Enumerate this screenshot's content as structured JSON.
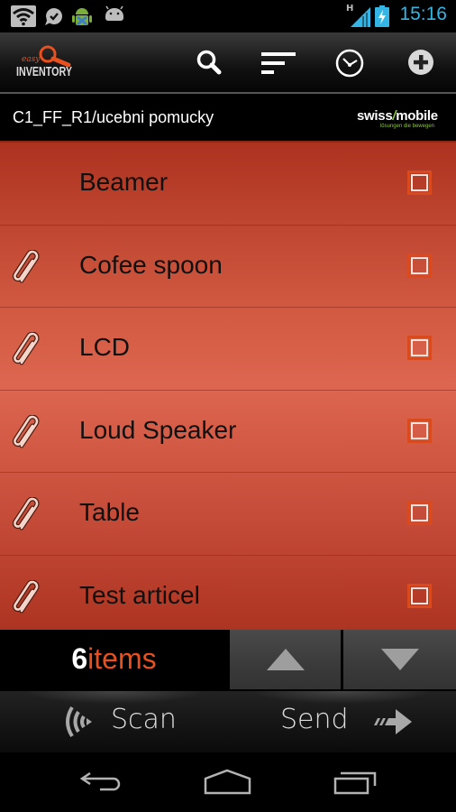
{
  "status_bar": {
    "time": "15:16",
    "network_type": "H",
    "icons": [
      "wifi-icon",
      "check-notification-icon",
      "android-download-icon",
      "android-icon",
      "signal-icon",
      "battery-charging-icon"
    ]
  },
  "action_bar": {
    "app_name": "easy INVENTORY",
    "actions": [
      "search-icon",
      "sort-icon",
      "history-clock-icon",
      "add-icon"
    ]
  },
  "location": {
    "path": "C1_FF_R1/ucebni pomucky",
    "brand_name": "swiss1mobile",
    "brand_tagline": "lösungen die bewegen"
  },
  "items": [
    {
      "label": "Beamer",
      "has_attachment": false,
      "checked": false
    },
    {
      "label": "Cofee spoon",
      "has_attachment": true,
      "checked": false
    },
    {
      "label": "LCD",
      "has_attachment": true,
      "checked": false
    },
    {
      "label": "Loud Speaker",
      "has_attachment": true,
      "checked": false
    },
    {
      "label": "Table",
      "has_attachment": true,
      "checked": false
    },
    {
      "label": "Test articel",
      "has_attachment": true,
      "checked": false
    }
  ],
  "footer": {
    "count": "6",
    "count_label": "items",
    "scan_label": "Scan",
    "send_label": "Send"
  },
  "colors": {
    "accent": "#e8501e",
    "time_blue": "#33b5e5",
    "list_red": "#d25a42",
    "brand_green": "#8dc63f"
  }
}
